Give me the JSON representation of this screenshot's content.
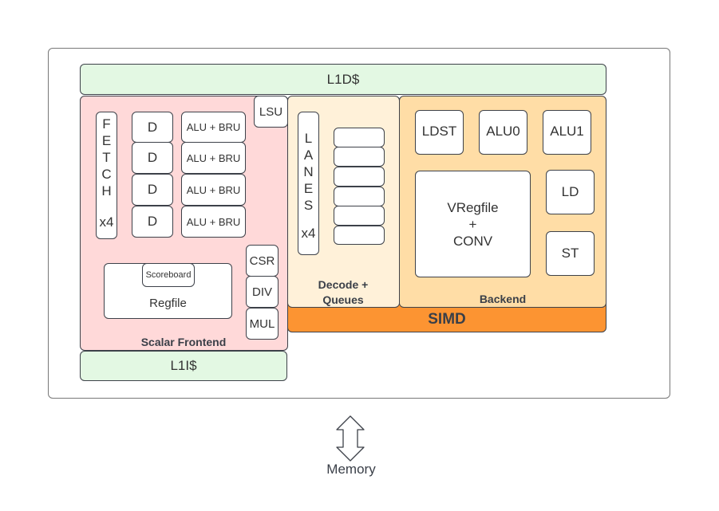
{
  "l1d": "L1D$",
  "l1i": "L1I$",
  "scalar": {
    "label": "Scalar Frontend",
    "fetch": [
      "F",
      "E",
      "T",
      "C",
      "H"
    ],
    "fetch_count": "x4",
    "decode": [
      "D",
      "D",
      "D",
      "D"
    ],
    "alu": [
      "ALU + BRU",
      "ALU + BRU",
      "ALU + BRU",
      "ALU + BRU"
    ],
    "lsu": "LSU",
    "scoreboard": "Scoreboard",
    "regfile": "Regfile",
    "csr": "CSR",
    "div": "DIV",
    "mul": "MUL"
  },
  "decode": {
    "label_1": "Decode +",
    "label_2": "Queues",
    "lanes": [
      "L",
      "A",
      "N",
      "E",
      "S"
    ],
    "lanes_count": "x4"
  },
  "backend": {
    "label": "Backend",
    "ldst": "LDST",
    "alu0": "ALU0",
    "alu1": "ALU1",
    "vregfile_1": "VRegfile",
    "vregfile_2": "+",
    "vregfile_3": "CONV",
    "ld": "LD",
    "st": "ST"
  },
  "simd": "SIMD",
  "memory": "Memory",
  "colors": {
    "l1": "#e3f8e3",
    "scalar": "#ffd9d9",
    "decode": "#fff1d9",
    "backend": "#ffdda6",
    "simd": "#fc9432"
  }
}
